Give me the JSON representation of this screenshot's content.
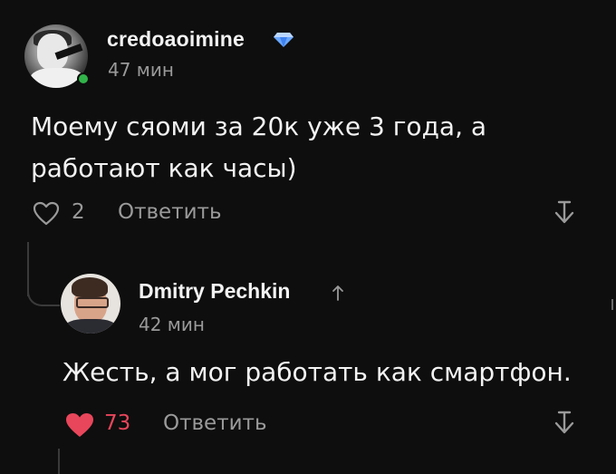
{
  "comments": [
    {
      "username": "credoaoimine",
      "badge_icon": "diamond-icon",
      "badge_color": "#6aa8ff",
      "online": true,
      "online_color": "#32b34a",
      "time": "47 мин",
      "text": "Моему сяоми за 20к уже 3 года, а работают как часы)",
      "likes": "2",
      "liked": false,
      "reply_label": "Ответить",
      "collapse_icon": "collapse-thread-icon"
    },
    {
      "username": "Dmitry Pechkin",
      "badge_icon": "up-arrow-icon",
      "time": "42 мин",
      "text": "Жесть, а мог работать как смартфон.",
      "likes": "73",
      "liked": true,
      "like_color": "#e8465b",
      "reply_label": "Ответить",
      "collapse_icon": "collapse-thread-icon"
    }
  ],
  "colors": {
    "background": "#0e0e0e",
    "text": "#f2f2f2",
    "muted": "#9a9a9a",
    "thread_line": "#3a3a3a"
  }
}
